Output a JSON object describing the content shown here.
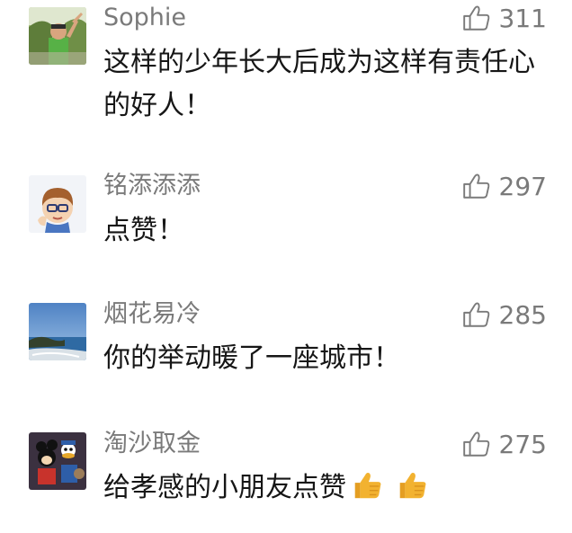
{
  "comments": [
    {
      "user": "Sophie",
      "likes": "311",
      "text": "这样的少年长大后成为这样有责任心的好人！",
      "avatar_icon": "boy-photo-avatar"
    },
    {
      "user": "铭添添添",
      "likes": "297",
      "text": "点赞！",
      "avatar_icon": "cartoon-boy-avatar"
    },
    {
      "user": "烟花易冷",
      "likes": "285",
      "text": "你的举动暖了一座城市！",
      "avatar_icon": "seaside-photo-avatar"
    },
    {
      "user": "淘沙取金",
      "likes": "275",
      "text": "给孝感的小朋友点赞",
      "emojis": [
        "thumbs-up-emoji",
        "thumbs-up-emoji"
      ],
      "avatar_icon": "cartoon-characters-avatar"
    }
  ],
  "colors": {
    "name": "#7a7a7a",
    "text": "#161616",
    "like": "#7a7a7a",
    "emoji": "#f2b230"
  }
}
